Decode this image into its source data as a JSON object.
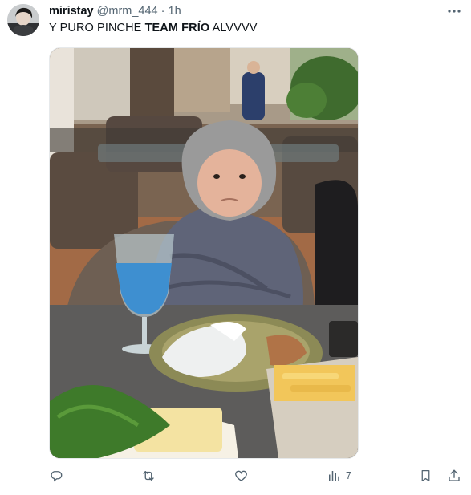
{
  "tweet": {
    "display_name": "miristay",
    "handle": "@mrm_444",
    "separator": "·",
    "time": "1h",
    "text_before": "Y PURO PINCHE ",
    "text_bold": "TEAM FRÍO",
    "text_after": " ALVVVV",
    "media": {
      "description_icon": "photo-icon"
    }
  },
  "actions": {
    "reply": {
      "icon": "reply-icon"
    },
    "retweet": {
      "icon": "retweet-icon"
    },
    "like": {
      "icon": "heart-icon"
    },
    "views": {
      "icon": "views-icon",
      "count": "7"
    },
    "bookmark": {
      "icon": "bookmark-icon"
    },
    "share": {
      "icon": "share-icon"
    }
  },
  "colors": {
    "text_primary": "#0f1419",
    "text_secondary": "#536471",
    "background": "#ffffff"
  }
}
